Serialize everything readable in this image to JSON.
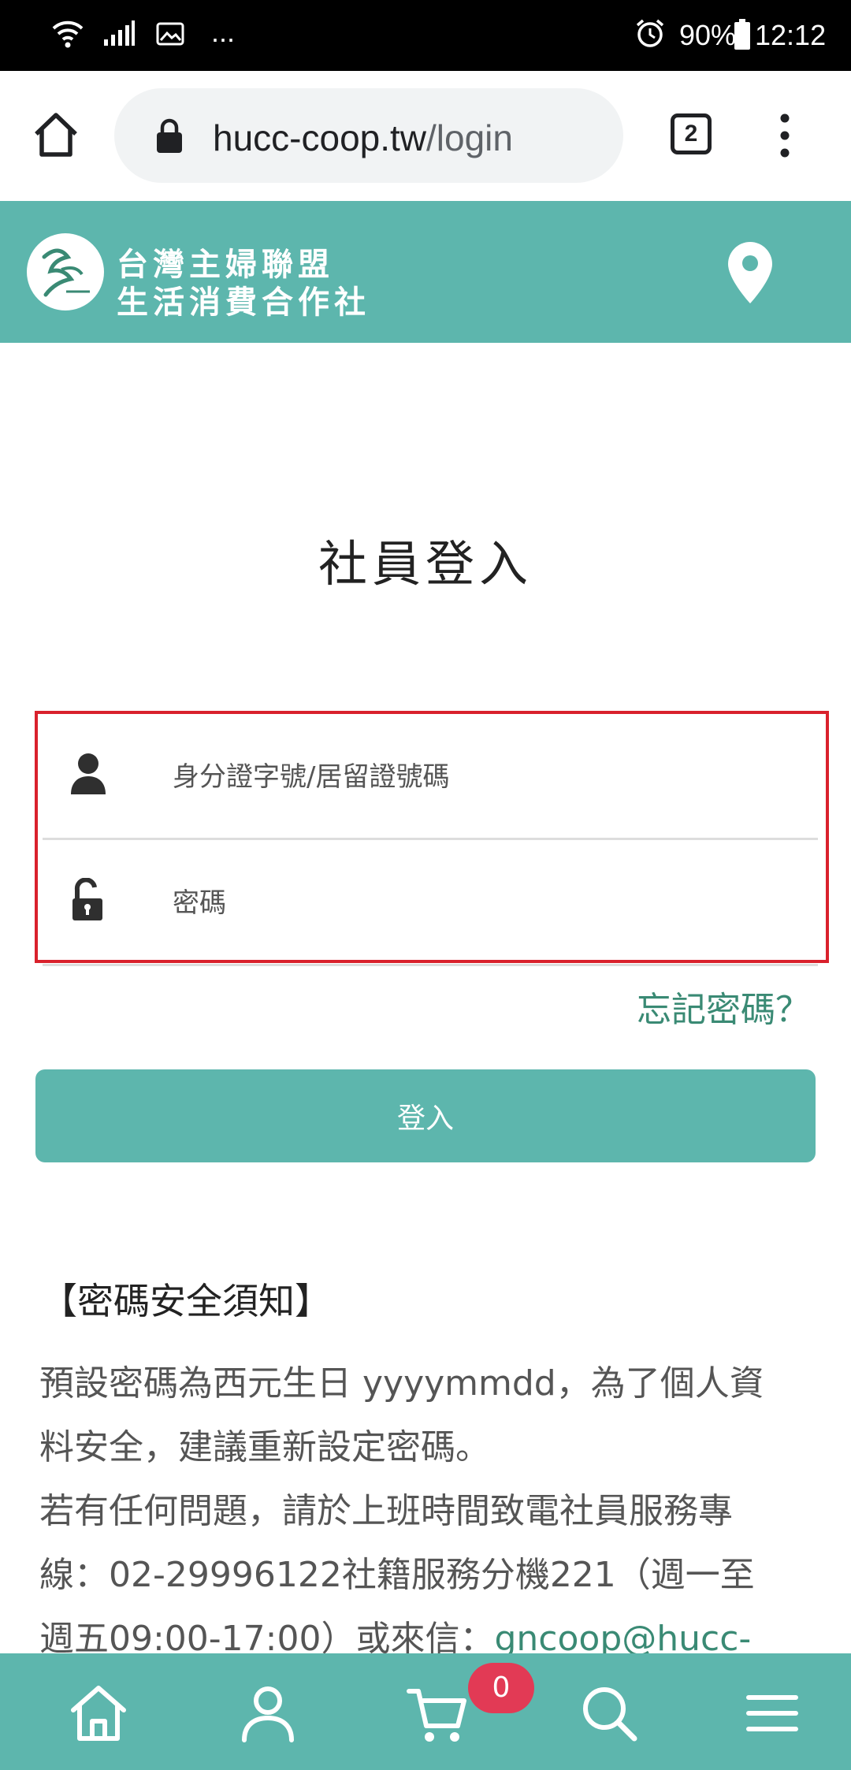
{
  "status_bar": {
    "battery": "90%",
    "time": "12:12",
    "more": "..."
  },
  "browser": {
    "url_host": "hucc-coop.tw",
    "url_path": "/login",
    "tab_count": "2"
  },
  "header": {
    "brand_line1": "台灣主婦聯盟",
    "brand_line2": "生活消費合作社"
  },
  "login": {
    "title": "社員登入",
    "id_placeholder": "身分證字號/居留證號碼",
    "password_placeholder": "密碼",
    "forgot_password": "忘記密碼？",
    "submit_label": "登入"
  },
  "notice": {
    "title": "【密碼安全須知】",
    "line1": "預設密碼為西元生日 yyyymmdd，為了個人資",
    "line2": "料安全，建議重新設定密碼。",
    "line3": "若有任何問題，請於上班時間致電社員服務專",
    "line4": "線：02-29996122社籍服務分機221（週一至",
    "line5_text": "週五09:00-17:00）或來信：",
    "line5_email": "gncoop@hucc-"
  },
  "bottom_nav": {
    "cart_count": "0"
  },
  "colors": {
    "brand_teal": "#5db6ad",
    "link_green": "#3a8a74",
    "highlight_red": "#d9212c",
    "badge_red": "#e23a55"
  }
}
